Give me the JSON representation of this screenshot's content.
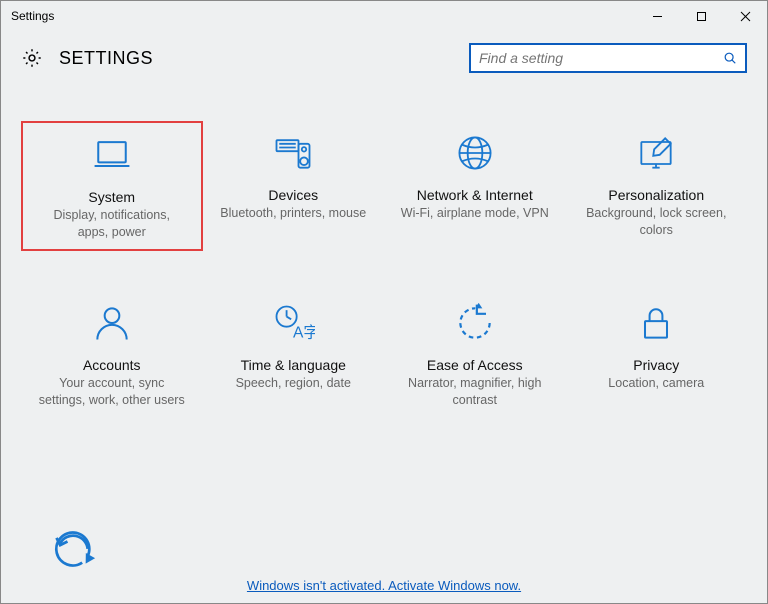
{
  "window_title": "Settings",
  "header_title": "SETTINGS",
  "search": {
    "placeholder": "Find a setting"
  },
  "tiles": {
    "system": {
      "title": "System",
      "desc": "Display, notifications, apps, power"
    },
    "devices": {
      "title": "Devices",
      "desc": "Bluetooth, printers, mouse"
    },
    "network": {
      "title": "Network & Internet",
      "desc": "Wi-Fi, airplane mode, VPN"
    },
    "personalize": {
      "title": "Personalization",
      "desc": "Background, lock screen, colors"
    },
    "accounts": {
      "title": "Accounts",
      "desc": "Your account, sync settings, work, other users"
    },
    "time": {
      "title": "Time & language",
      "desc": "Speech, region, date"
    },
    "ease": {
      "title": "Ease of Access",
      "desc": "Narrator, magnifier, high contrast"
    },
    "privacy": {
      "title": "Privacy",
      "desc": "Location, camera"
    }
  },
  "activation_text": "Windows isn't activated. Activate Windows now."
}
